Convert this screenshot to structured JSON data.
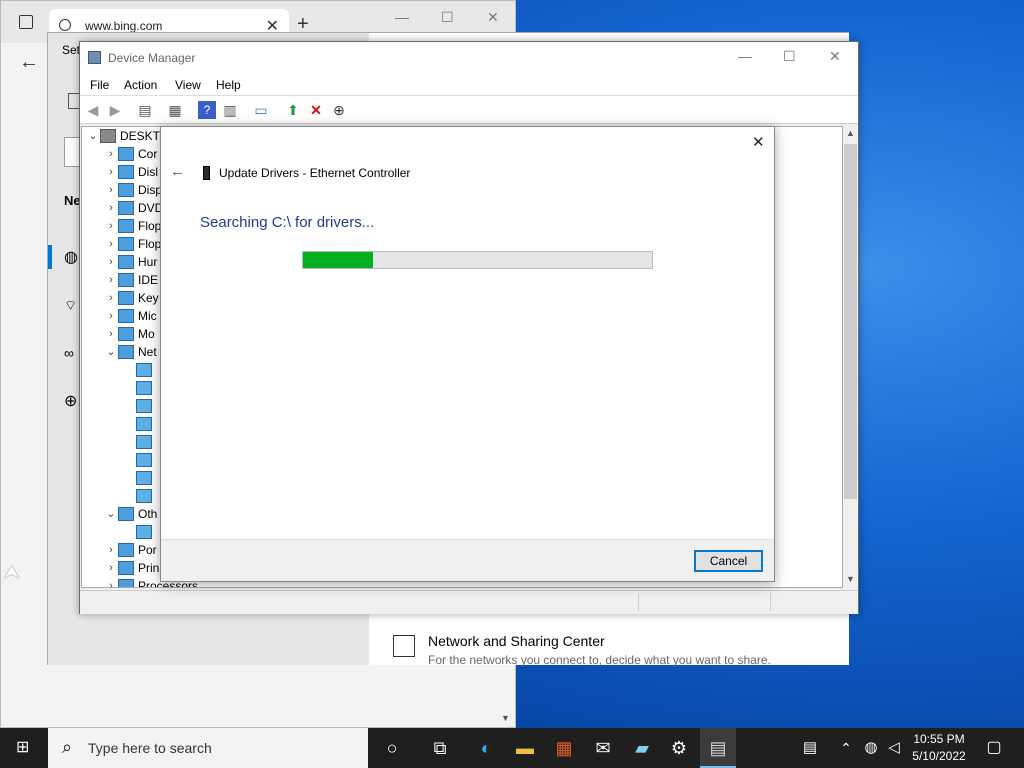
{
  "browser": {
    "tab_title": "www.bing.com",
    "window_min": "—",
    "window_max": "☐",
    "window_close": "✕",
    "new_tab": "+"
  },
  "settings": {
    "title_fragment": "Set",
    "ne_fragment": "Ne",
    "network_sharing_title": "Network and Sharing Center",
    "network_sharing_desc": "For the networks you connect to, decide what you want to share."
  },
  "device_manager": {
    "title": "Device Manager",
    "menu": [
      "File",
      "Action",
      "View",
      "Help"
    ],
    "tree": [
      {
        "label": "DESKTO",
        "level": 0,
        "expanded": true
      },
      {
        "label": "Cor",
        "level": 1
      },
      {
        "label": "Disl",
        "level": 1
      },
      {
        "label": "Disp",
        "level": 1
      },
      {
        "label": "DVD",
        "level": 1
      },
      {
        "label": "Flop",
        "level": 1
      },
      {
        "label": "Flop",
        "level": 1
      },
      {
        "label": "Hur",
        "level": 1
      },
      {
        "label": "IDE",
        "level": 1
      },
      {
        "label": "Key",
        "level": 1
      },
      {
        "label": "Mic",
        "level": 1
      },
      {
        "label": "Mo",
        "level": 1
      },
      {
        "label": "Net",
        "level": 1,
        "expanded": true
      },
      {
        "label": "",
        "level": 2
      },
      {
        "label": "",
        "level": 2
      },
      {
        "label": "",
        "level": 2
      },
      {
        "label": "",
        "level": 2
      },
      {
        "label": "",
        "level": 2
      },
      {
        "label": "",
        "level": 2
      },
      {
        "label": "",
        "level": 2
      },
      {
        "label": "",
        "level": 2
      },
      {
        "label": "Oth",
        "level": 1,
        "expanded": true
      },
      {
        "label": "",
        "level": 2
      },
      {
        "label": "Por",
        "level": 1
      },
      {
        "label": "Prin",
        "level": 1
      },
      {
        "label": "Processors",
        "level": 1
      }
    ]
  },
  "dialog": {
    "close": "✕",
    "title": "Update Drivers - Ethernet Controller",
    "status": "Searching C:\\ for drivers...",
    "progress": 0.2,
    "cancel_label": "Cancel"
  },
  "taskbar": {
    "search_placeholder": "Type here to search",
    "time": "10:55 PM",
    "date": "5/10/2022"
  },
  "colors": {
    "accent": "#0078d7",
    "progress": "#06b025",
    "status_text": "#1e3d8c"
  }
}
